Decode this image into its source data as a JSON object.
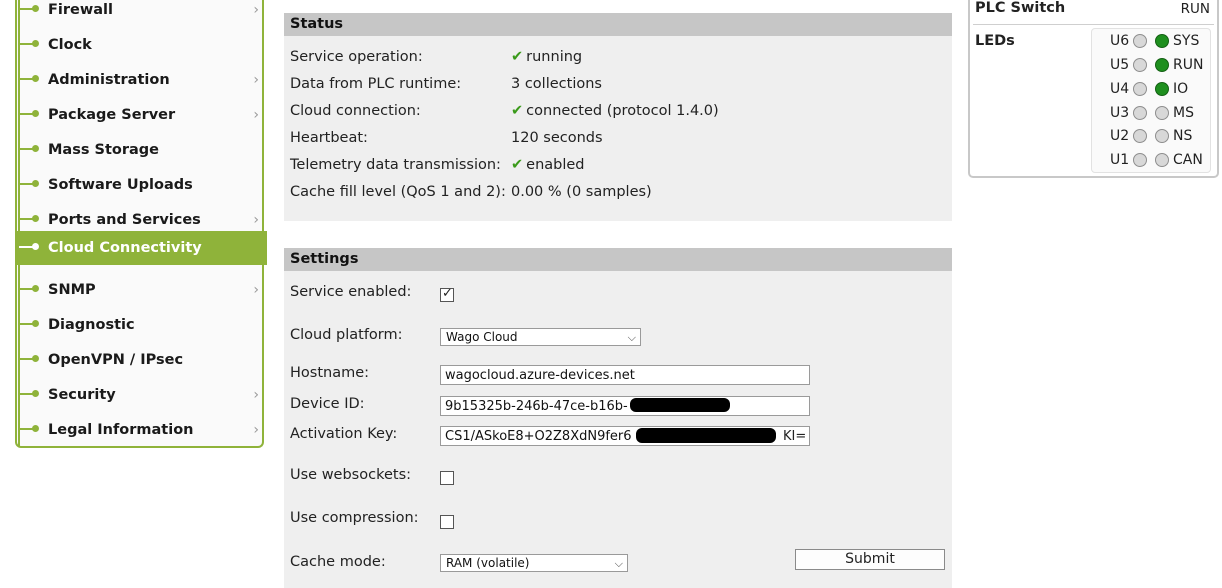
{
  "sidebar": {
    "items": [
      {
        "label": "Firewall",
        "chevron": true,
        "active": false
      },
      {
        "label": "Clock",
        "chevron": false,
        "active": false
      },
      {
        "label": "Administration",
        "chevron": true,
        "active": false
      },
      {
        "label": "Package Server",
        "chevron": true,
        "active": false
      },
      {
        "label": "Mass Storage",
        "chevron": false,
        "active": false
      },
      {
        "label": "Software Uploads",
        "chevron": false,
        "active": false
      },
      {
        "label": "Ports and Services",
        "chevron": true,
        "active": false
      },
      {
        "label": "Cloud Connectivity",
        "chevron": false,
        "active": true
      },
      {
        "label": "SNMP",
        "chevron": true,
        "active": false
      },
      {
        "label": "Diagnostic",
        "chevron": false,
        "active": false
      },
      {
        "label": "OpenVPN / IPsec",
        "chevron": false,
        "active": false
      },
      {
        "label": "Security",
        "chevron": true,
        "active": false
      },
      {
        "label": "Legal Information",
        "chevron": true,
        "active": false
      }
    ]
  },
  "status": {
    "title": "Status",
    "rows": [
      {
        "label": "Service operation:",
        "value": "running",
        "check": true
      },
      {
        "label": "Data from PLC runtime:",
        "value": "3 collections",
        "check": false
      },
      {
        "label": "Cloud connection:",
        "value": "connected (protocol 1.4.0)",
        "check": true
      },
      {
        "label": "Heartbeat:",
        "value": "120 seconds",
        "check": false
      },
      {
        "label": "Telemetry data transmission:",
        "value": "enabled",
        "check": true
      },
      {
        "label": "Cache fill level (QoS 1 and 2):",
        "value": "0.00 % (0 samples)",
        "check": false
      }
    ]
  },
  "settings": {
    "title": "Settings",
    "service_enabled_label": "Service enabled:",
    "service_enabled": true,
    "cloud_platform_label": "Cloud platform:",
    "cloud_platform_value": "Wago Cloud",
    "hostname_label": "Hostname:",
    "hostname_value": "wagocloud.azure-devices.net",
    "device_id_label": "Device ID:",
    "device_id_value": "9b15325b-246b-47ce-b16b-",
    "activation_key_label": "Activation Key:",
    "activation_key_value": "CS1/ASkoE8+O2Z8XdN9fer6",
    "activation_key_suffix": "KI=",
    "websockets_label": "Use websockets:",
    "websockets": false,
    "compression_label": "Use compression:",
    "compression": false,
    "cache_mode_label": "Cache mode:",
    "cache_mode_value": "RAM (volatile)",
    "submit_label": "Submit"
  },
  "plc": {
    "switch_label": "PLC Switch",
    "switch_value": "RUN",
    "leds_label": "LEDs",
    "leds": [
      {
        "u": "U6",
        "name": "SYS",
        "on": true
      },
      {
        "u": "U5",
        "name": "RUN",
        "on": true
      },
      {
        "u": "U4",
        "name": "IO",
        "on": true
      },
      {
        "u": "U3",
        "name": "MS",
        "on": false
      },
      {
        "u": "U2",
        "name": "NS",
        "on": false
      },
      {
        "u": "U1",
        "name": "CAN",
        "on": false
      }
    ]
  },
  "colors": {
    "accent": "#8fb33a",
    "led_on": "#1e8f1e",
    "check": "#3a9a1a"
  }
}
